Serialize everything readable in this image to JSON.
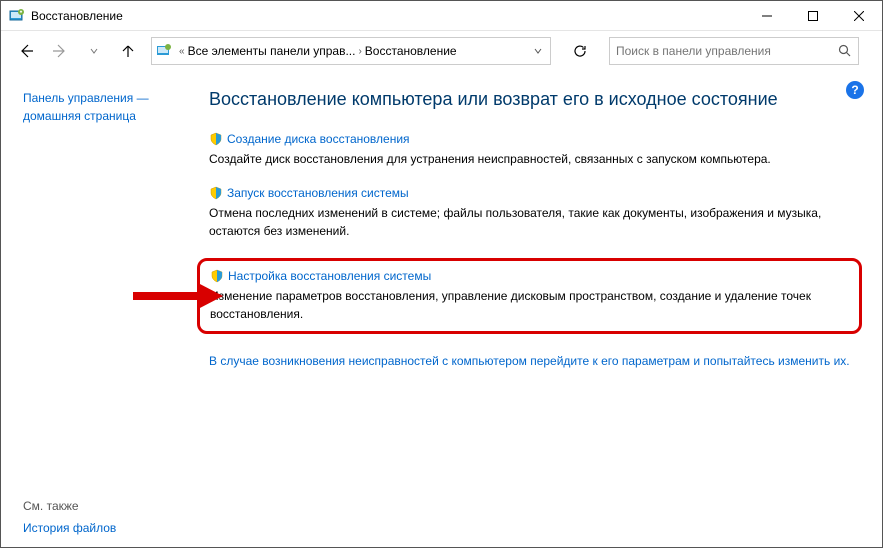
{
  "titlebar": {
    "title": "Восстановление"
  },
  "breadcrumb": {
    "item1": "Все элементы панели управ...",
    "item2": "Восстановление"
  },
  "search": {
    "placeholder": "Поиск в панели управления"
  },
  "sidebar": {
    "home_link": "Панель управления — домашняя страница",
    "see_also": "См. также",
    "history": "История файлов"
  },
  "main": {
    "title": "Восстановление компьютера или возврат его в исходное состояние",
    "options": [
      {
        "link": "Создание диска восстановления",
        "desc": "Создайте диск восстановления для устранения неисправностей, связанных с запуском компьютера."
      },
      {
        "link": "Запуск восстановления системы",
        "desc": "Отмена последних изменений в системе; файлы пользователя, такие как документы, изображения и музыка, остаются без изменений."
      },
      {
        "link": "Настройка восстановления системы",
        "desc": "Изменение параметров восстановления, управление дисковым пространством, создание и удаление точек восстановления."
      }
    ],
    "footer_link": "В случае возникновения неисправностей с компьютером перейдите к его параметрам и попытайтесь изменить их."
  },
  "help": "?"
}
